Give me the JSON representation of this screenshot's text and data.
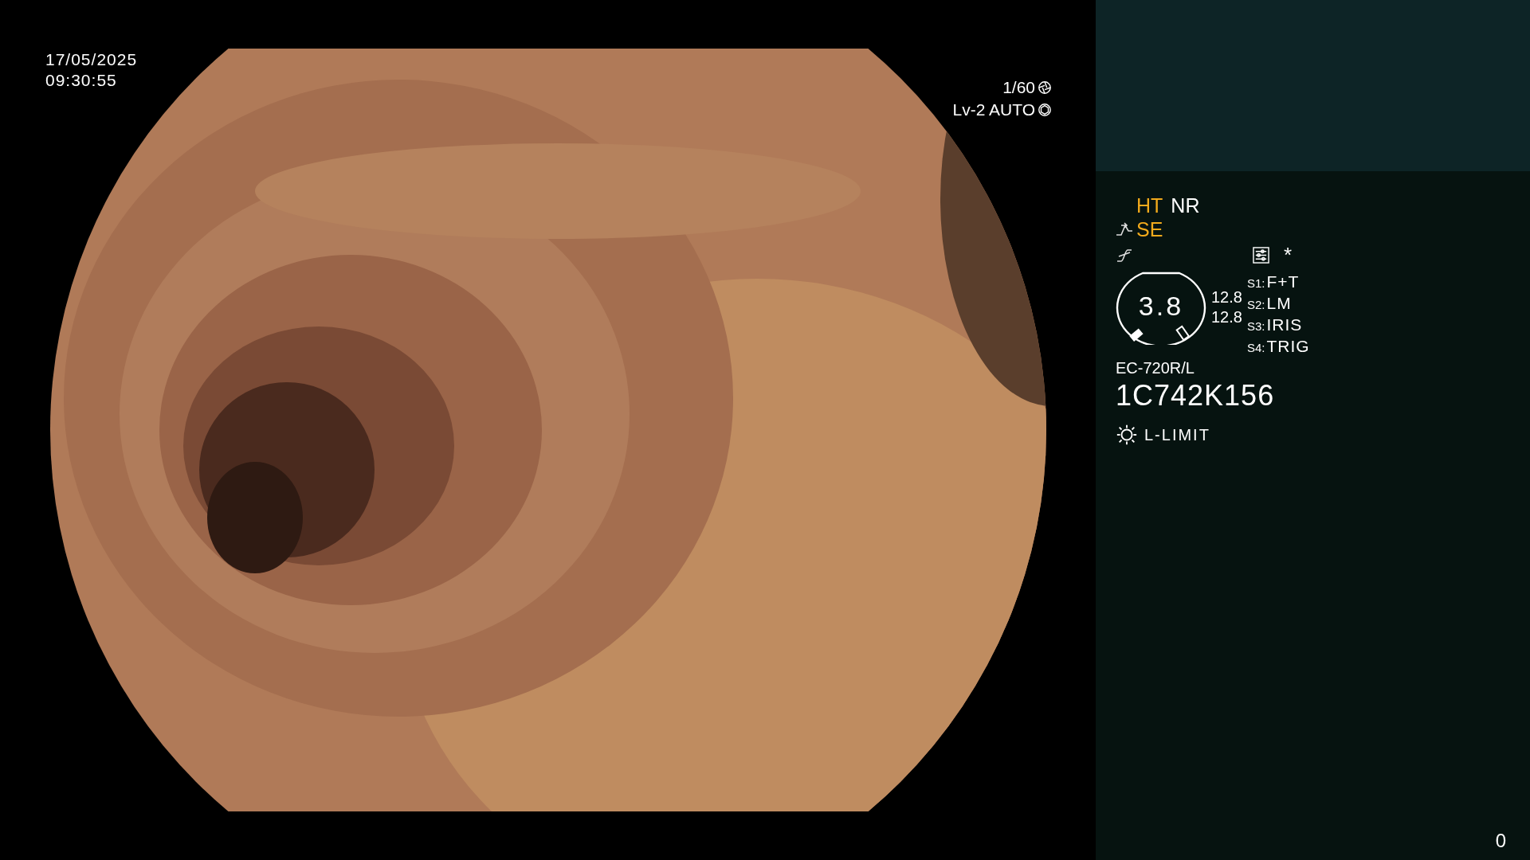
{
  "timestamp": {
    "date": "17/05/2025",
    "time": "09:30:55"
  },
  "exposure": {
    "shutter": "1/60",
    "mode": "Lv-2 AUTO"
  },
  "panel": {
    "tags": [
      {
        "label": "HT",
        "color": "#f2aa1c"
      },
      {
        "label": "NR",
        "color": "#ffffff"
      }
    ],
    "enhance": {
      "label": "SE",
      "color": "#f2aa1c"
    },
    "asterisk": "*",
    "gauge": {
      "value": "3.8"
    },
    "readings": [
      "12.8",
      "12.8"
    ],
    "switches": [
      {
        "key": "S1:",
        "value": "F+T"
      },
      {
        "key": "S2:",
        "value": "LM"
      },
      {
        "key": "S3:",
        "value": "IRIS"
      },
      {
        "key": "S4:",
        "value": "TRIG"
      }
    ],
    "scope_model": "EC-720R/L",
    "serial": "1C742K156",
    "light": "L-LIMIT"
  },
  "counter": "0"
}
